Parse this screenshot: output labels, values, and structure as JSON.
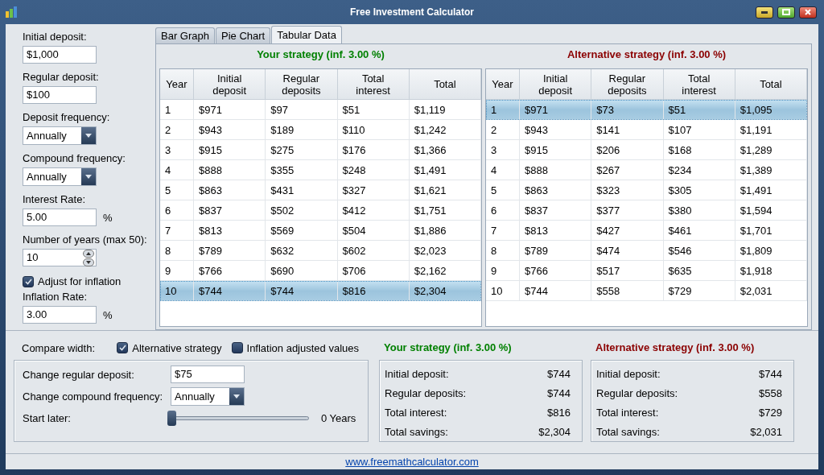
{
  "window": {
    "title": "Free Investment Calculator"
  },
  "fields": [
    {
      "kind": "text",
      "label": "Initial deposit:",
      "value": "$1,000"
    },
    {
      "kind": "text",
      "label": "Regular deposit:",
      "value": "$100"
    },
    {
      "kind": "select",
      "label": "Deposit frequency:",
      "value": "Annually"
    },
    {
      "kind": "select",
      "label": "Compound frequency:",
      "value": "Annually"
    },
    {
      "kind": "text",
      "label": "Interest Rate:",
      "value": "5.00",
      "unit": "%"
    },
    {
      "kind": "spinner",
      "label": "Number of years (max 50):",
      "value": "10"
    },
    {
      "kind": "checkbox",
      "label": "Adjust for inflation",
      "checked": true
    },
    {
      "kind": "text",
      "label": "Inflation Rate:",
      "value": "3.00",
      "unit": "%"
    }
  ],
  "tabs": [
    {
      "label": "Bar Graph",
      "selected": false
    },
    {
      "label": "Pie Chart",
      "selected": false
    },
    {
      "label": "Tabular Data",
      "selected": true
    }
  ],
  "tables": [
    {
      "title": "Your strategy (inf. 3.00 %)",
      "color": "#008000",
      "columns": [
        "Year",
        "Initial deposit",
        "Regular deposits",
        "Total interest",
        "Total"
      ],
      "rows": [
        {
          "cells": [
            "1",
            "$971",
            "$97",
            "$51",
            "$1,119"
          ],
          "selected": false
        },
        {
          "cells": [
            "2",
            "$943",
            "$189",
            "$110",
            "$1,242"
          ],
          "selected": false
        },
        {
          "cells": [
            "3",
            "$915",
            "$275",
            "$176",
            "$1,366"
          ],
          "selected": false
        },
        {
          "cells": [
            "4",
            "$888",
            "$355",
            "$248",
            "$1,491"
          ],
          "selected": false
        },
        {
          "cells": [
            "5",
            "$863",
            "$431",
            "$327",
            "$1,621"
          ],
          "selected": false
        },
        {
          "cells": [
            "6",
            "$837",
            "$502",
            "$412",
            "$1,751"
          ],
          "selected": false
        },
        {
          "cells": [
            "7",
            "$813",
            "$569",
            "$504",
            "$1,886"
          ],
          "selected": false
        },
        {
          "cells": [
            "8",
            "$789",
            "$632",
            "$602",
            "$2,023"
          ],
          "selected": false
        },
        {
          "cells": [
            "9",
            "$766",
            "$690",
            "$706",
            "$2,162"
          ],
          "selected": false
        },
        {
          "cells": [
            "10",
            "$744",
            "$744",
            "$816",
            "$2,304"
          ],
          "selected": true
        }
      ]
    },
    {
      "title": "Alternative strategy (inf. 3.00 %)",
      "color": "#8b0000",
      "columns": [
        "Year",
        "Initial deposit",
        "Regular deposits",
        "Total interest",
        "Total"
      ],
      "rows": [
        {
          "cells": [
            "1",
            "$971",
            "$73",
            "$51",
            "$1,095"
          ],
          "selected": true
        },
        {
          "cells": [
            "2",
            "$943",
            "$141",
            "$107",
            "$1,191"
          ],
          "selected": false
        },
        {
          "cells": [
            "3",
            "$915",
            "$206",
            "$168",
            "$1,289"
          ],
          "selected": false
        },
        {
          "cells": [
            "4",
            "$888",
            "$267",
            "$234",
            "$1,389"
          ],
          "selected": false
        },
        {
          "cells": [
            "5",
            "$863",
            "$323",
            "$305",
            "$1,491"
          ],
          "selected": false
        },
        {
          "cells": [
            "6",
            "$837",
            "$377",
            "$380",
            "$1,594"
          ],
          "selected": false
        },
        {
          "cells": [
            "7",
            "$813",
            "$427",
            "$461",
            "$1,701"
          ],
          "selected": false
        },
        {
          "cells": [
            "8",
            "$789",
            "$474",
            "$546",
            "$1,809"
          ],
          "selected": false
        },
        {
          "cells": [
            "9",
            "$766",
            "$517",
            "$635",
            "$1,918"
          ],
          "selected": false
        },
        {
          "cells": [
            "10",
            "$744",
            "$558",
            "$729",
            "$2,031"
          ],
          "selected": false
        }
      ]
    }
  ],
  "compare": {
    "label": "Compare width:",
    "options": [
      {
        "label": "Alternative strategy",
        "checked": true
      },
      {
        "label": "Inflation adjusted values",
        "checked": false
      }
    ]
  },
  "alternative": {
    "deposit": {
      "label": "Change regular deposit:",
      "value": "$75"
    },
    "frequency": {
      "label": "Change compound frequency:",
      "value": "Annually"
    },
    "start": {
      "label": "Start later:",
      "level": 0,
      "reading": "0 Years"
    }
  },
  "summaries": [
    {
      "title": "Your strategy (inf. 3.00 %)",
      "color": "#008000",
      "items": [
        {
          "label": "Initial deposit:",
          "value": "$744"
        },
        {
          "label": "Regular deposits:",
          "value": "$744"
        },
        {
          "label": "Total interest:",
          "value": "$816"
        },
        {
          "label": "Total savings:",
          "value": "$2,304"
        }
      ]
    },
    {
      "title": "Alternative strategy (inf. 3.00 %)",
      "color": "#8b0000",
      "items": [
        {
          "label": "Initial deposit:",
          "value": "$744"
        },
        {
          "label": "Regular deposits:",
          "value": "$558"
        },
        {
          "label": "Total interest:",
          "value": "$729"
        },
        {
          "label": "Total savings:",
          "value": "$2,031"
        }
      ]
    }
  ],
  "footer": {
    "link": "www.freemathcalculator.com"
  }
}
